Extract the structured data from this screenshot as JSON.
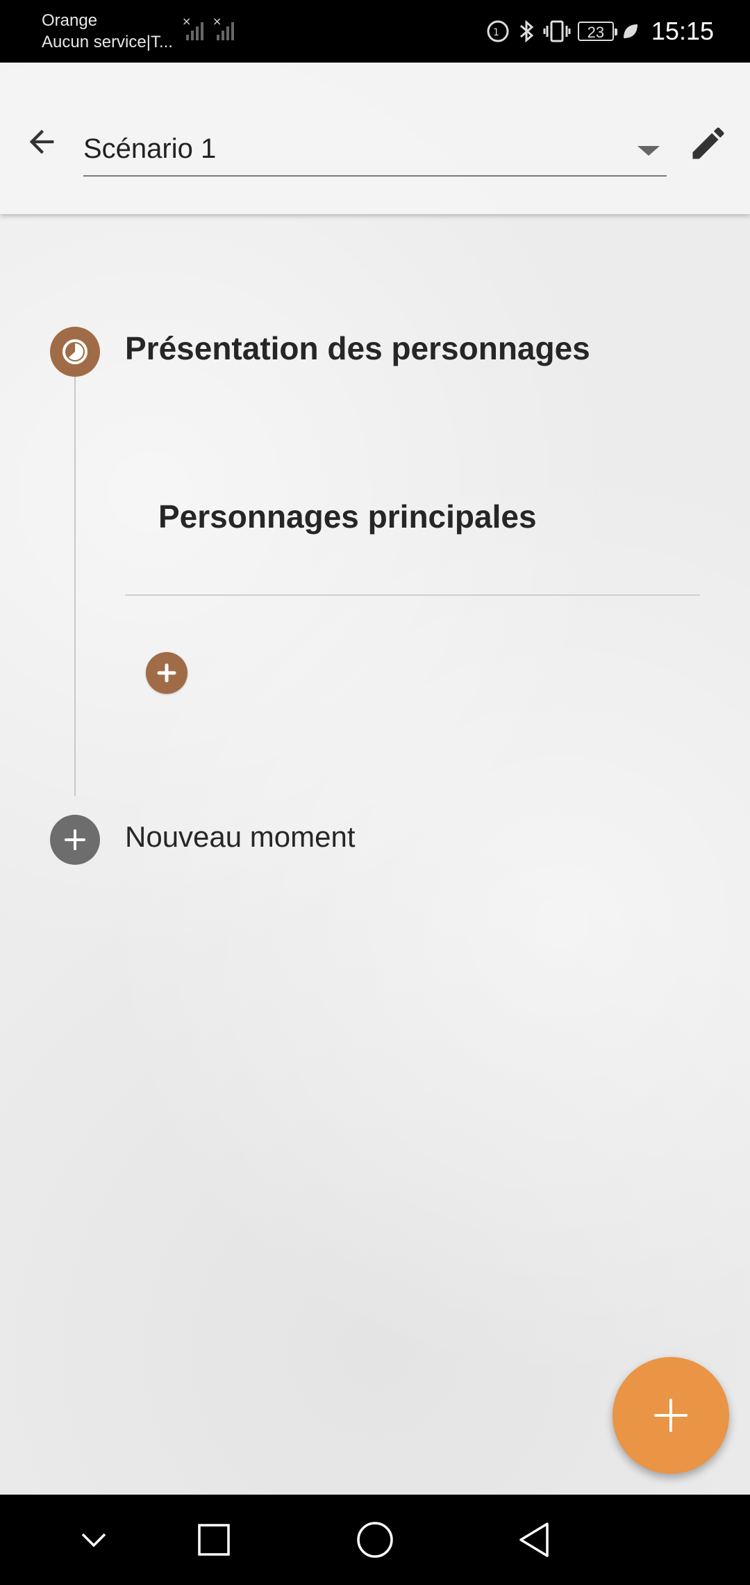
{
  "status_bar": {
    "carrier_name": "Orange",
    "carrier_status": "Aucun service|T...",
    "battery_level": "23",
    "time": "15:15"
  },
  "toolbar": {
    "scenario_selected": "Scénario 1"
  },
  "timeline": {
    "moment_title": "Présentation des personnages",
    "card_title": "Personnages principales",
    "new_moment_label": "Nouveau moment"
  },
  "colors": {
    "accent_brown": "#a06c47",
    "fab_orange": "#ea9446",
    "new_moment_gray": "#6d6d6d"
  },
  "icons": {
    "back": "arrow-left-icon",
    "edit": "pencil-icon",
    "moment": "clock-icon",
    "add": "plus-icon",
    "nav_down": "chevron-down-icon",
    "nav_recents": "square-icon",
    "nav_home": "circle-icon",
    "nav_back": "triangle-back-icon"
  }
}
